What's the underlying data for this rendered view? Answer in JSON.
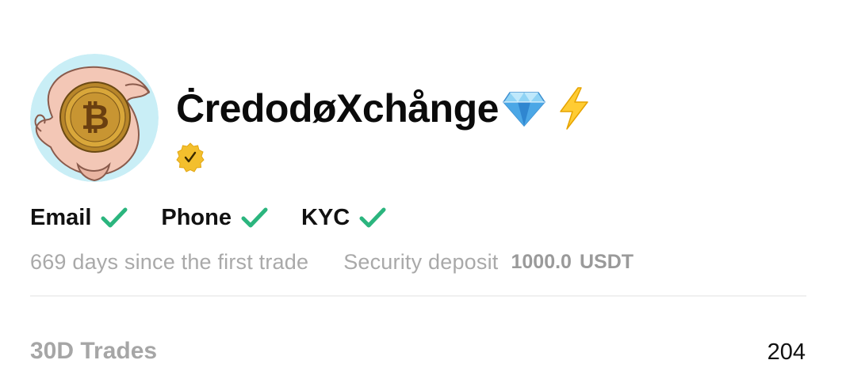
{
  "profile": {
    "name": "ĊredodøXchånge",
    "badges": [
      "diamond-icon",
      "bolt-icon"
    ],
    "verified_mark": "✓"
  },
  "verifications": [
    {
      "label": "Email",
      "verified": true
    },
    {
      "label": "Phone",
      "verified": true
    },
    {
      "label": "KYC",
      "verified": true
    }
  ],
  "info": {
    "days_since_first_trade": "669 days since the first trade",
    "security_deposit_label": "Security deposit",
    "security_deposit_value": "1000.0",
    "security_deposit_unit": "USDT"
  },
  "stats": {
    "trades_30d_label": "30D Trades",
    "trades_30d_value": "204"
  },
  "colors": {
    "check_green": "#2bb57e",
    "muted_text": "#a6a6a6",
    "badge_gold": "#f2c12e"
  }
}
